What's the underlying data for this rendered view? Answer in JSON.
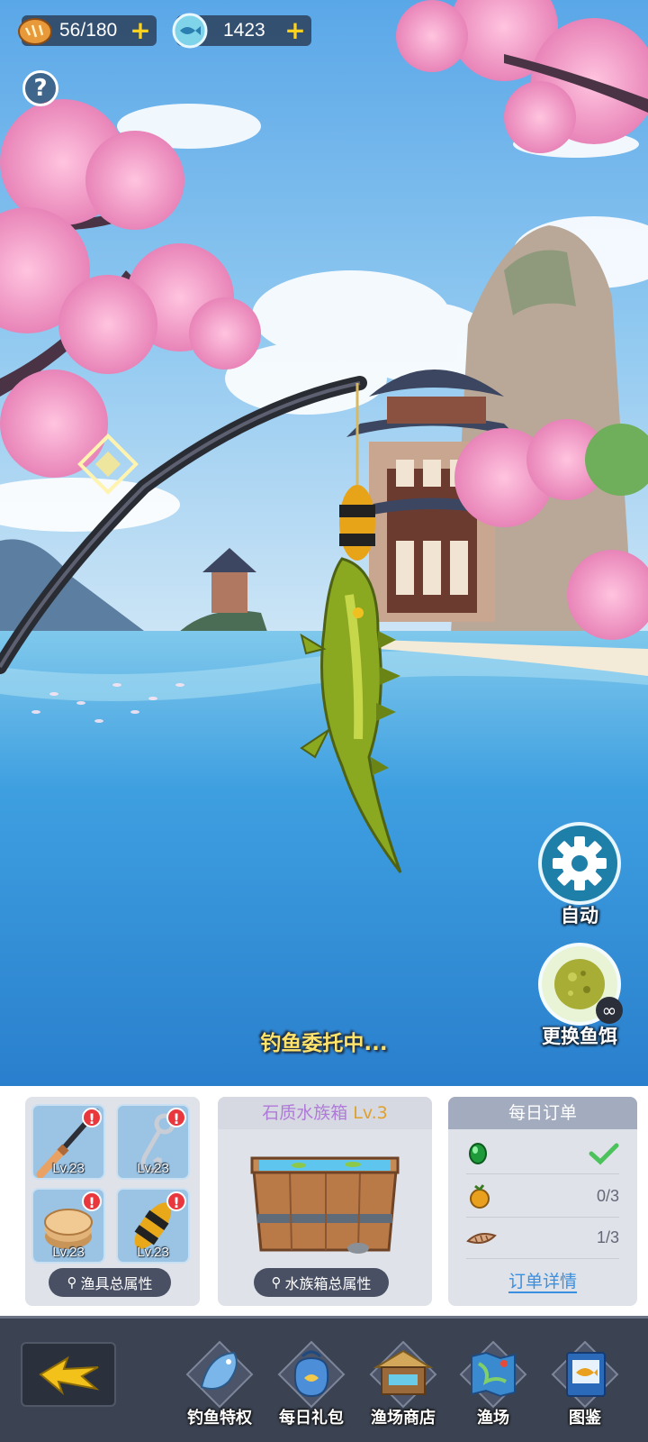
{
  "resources": {
    "bread": {
      "value": "56/180",
      "plus": "+"
    },
    "fish_coin": {
      "value": "1423",
      "plus": "+"
    }
  },
  "help": {
    "symbol": "?"
  },
  "side_buttons": {
    "auto": {
      "label": "自动"
    },
    "bait": {
      "label": "更换鱼饵",
      "badge": "∞"
    }
  },
  "status_text": "钓鱼委托中...",
  "gear": {
    "slots": [
      {
        "icon": "fishing-rod-icon",
        "level": "Lv.23",
        "alert": "!"
      },
      {
        "icon": "hook-icon",
        "level": "Lv.23",
        "alert": "!"
      },
      {
        "icon": "line-reel-icon",
        "level": "Lv.23",
        "alert": "!"
      },
      {
        "icon": "float-bobber-icon",
        "level": "Lv.23",
        "alert": "!"
      }
    ],
    "button_label": "渔具总属性"
  },
  "tank": {
    "title": "石质水族箱",
    "level": "Lv.3",
    "button_label": "水族箱总属性"
  },
  "orders": {
    "title": "每日订单",
    "items": [
      {
        "icon": "green-gem-icon",
        "count": "✓",
        "done": true
      },
      {
        "icon": "orange-fruit-icon",
        "count": "0/3",
        "done": false
      },
      {
        "icon": "shell-icon",
        "count": "1/3",
        "done": false
      }
    ],
    "detail_label": "订单详情"
  },
  "nav": {
    "items": [
      {
        "label": "钓鱼特权",
        "icon": "fish-privilege-icon"
      },
      {
        "label": "每日礼包",
        "icon": "daily-gift-bag-icon"
      },
      {
        "label": "渔场商店",
        "icon": "shop-stall-icon"
      },
      {
        "label": "渔场",
        "icon": "fishing-map-icon"
      },
      {
        "label": "图鉴",
        "icon": "encyclopedia-book-icon"
      }
    ]
  },
  "colors": {
    "accent_yellow": "#ffd21e",
    "status_yellow": "#ffe36a",
    "link_blue": "#3a8fe0",
    "alert_red": "#e8383d"
  }
}
